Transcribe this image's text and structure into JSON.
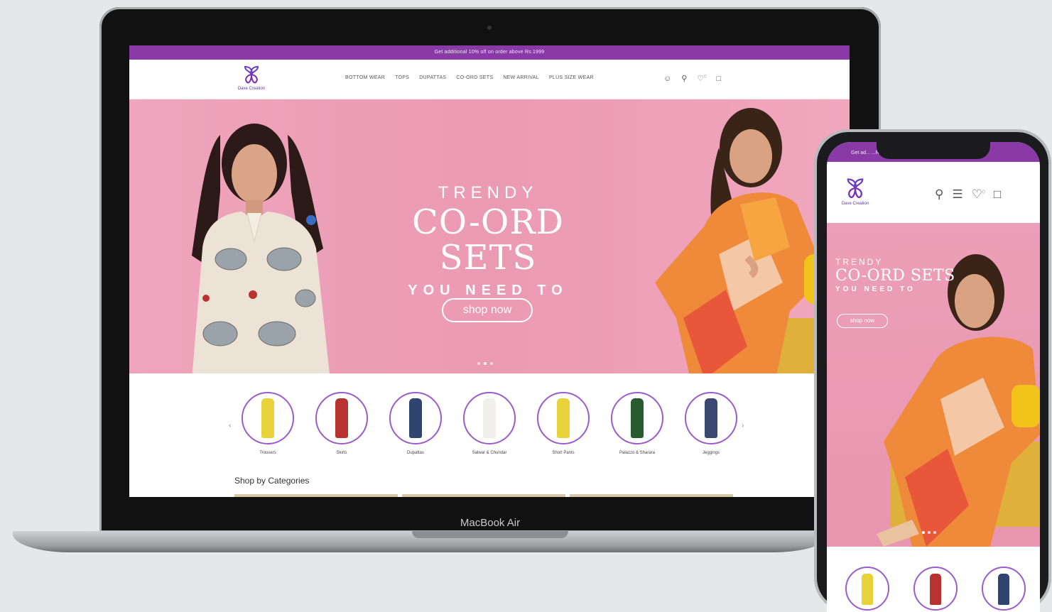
{
  "brand": {
    "name": "Dave Creation",
    "accent": "#8a3aa6",
    "hero_pink": "#eb9ab3"
  },
  "desktop": {
    "promo_text": "Get additional 10% off on order above Rs.1999",
    "nav": [
      "BOTTOM WEAR",
      "TOPS",
      "DUPATTAS",
      "CO-ORD SETS",
      "NEW ARRIVAL",
      "PLUS SIZE WEAR"
    ],
    "icons": [
      "user-icon",
      "search-icon",
      "heart-icon",
      "bag-icon"
    ],
    "wishlist_count": "0",
    "hero": {
      "kicker": "TRENDY",
      "title": "CO-ORD SETS",
      "subtitle": "YOU NEED TO",
      "cta": "shop now",
      "slides_total": 3,
      "slide_active": 1
    },
    "categories": [
      {
        "label": "Trousers",
        "color": "#e8d23a"
      },
      {
        "label": "Skirts",
        "color": "#b8322f"
      },
      {
        "label": "Dupattas",
        "color": "#2f4470"
      },
      {
        "label": "Salwar & Churidar",
        "color": "#f1efe9"
      },
      {
        "label": "Short Pants",
        "color": "#e8d23a"
      },
      {
        "label": "Palazzo & Sharara",
        "color": "#2a5a2f"
      },
      {
        "label": "Jeggings",
        "color": "#3a4770"
      }
    ],
    "section_title": "Shop by Categories"
  },
  "laptop_label": "MacBook Air",
  "mobile": {
    "promo_text": "Get ad...                     ...Rs.1999",
    "wishlist_count": "0",
    "hero": {
      "kicker": "TRENDY",
      "title": "CO-ORD SETS",
      "subtitle": "YOU NEED TO",
      "cta": "shop now"
    },
    "categories": [
      {
        "color": "#e8d23a"
      },
      {
        "color": "#b8322f"
      },
      {
        "color": "#2f4470"
      }
    ]
  }
}
